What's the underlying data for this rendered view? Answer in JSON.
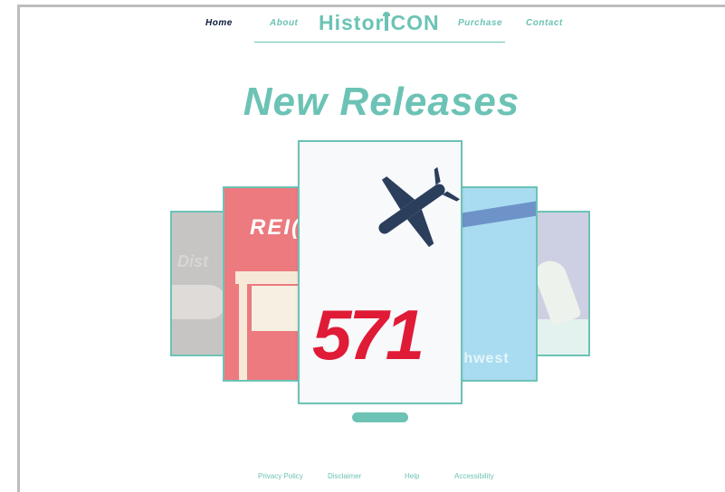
{
  "nav": {
    "links": [
      "Home",
      "About",
      "Purchase",
      "Contact"
    ],
    "logo_part1": "Histor",
    "logo_part2": "CON",
    "active_color": "#0b1a3a",
    "accent_color": "#6cc3b5"
  },
  "main": {
    "heading": "New Releases"
  },
  "carousel": {
    "cards": [
      {
        "label": "Dist"
      },
      {
        "label": "REI("
      },
      {
        "label": "571"
      },
      {
        "label": "thwest"
      },
      {
        "label": ""
      }
    ],
    "active_index": 2
  },
  "footer": {
    "links": [
      "Privacy Policy",
      "Disclaimer",
      "Help",
      "Accessibility"
    ]
  }
}
